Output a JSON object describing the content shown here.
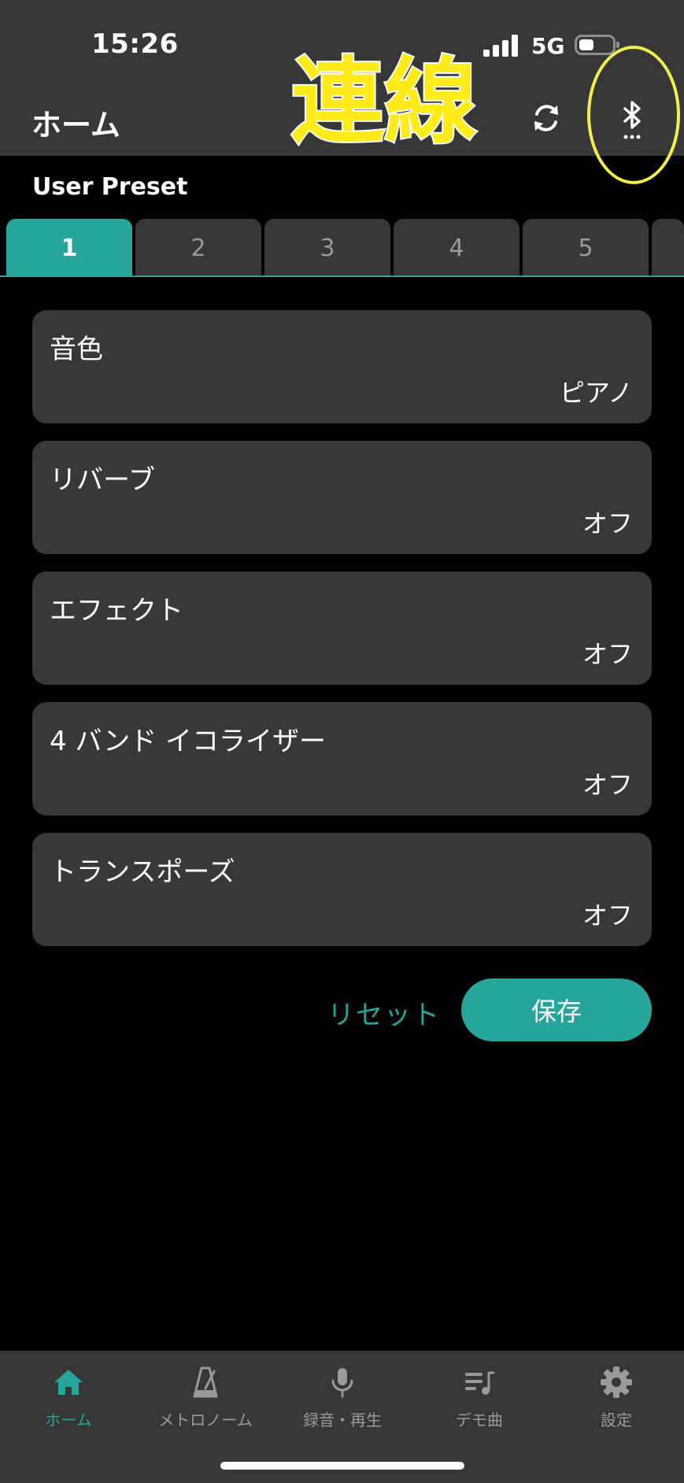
{
  "status_bar": {
    "time": "15:26",
    "network": "5G"
  },
  "header": {
    "title": "ホーム",
    "annotation": "連線"
  },
  "presets": {
    "label": "User Preset",
    "tabs": [
      "1",
      "2",
      "3",
      "4",
      "5"
    ],
    "active_index": 0
  },
  "settings": [
    {
      "label": "音色",
      "value": "ピアノ"
    },
    {
      "label": "リバーブ",
      "value": "オフ"
    },
    {
      "label": "エフェクト",
      "value": "オフ"
    },
    {
      "label": "4 バンド イコライザー",
      "value": "オフ"
    },
    {
      "label": "トランスポーズ",
      "value": "オフ"
    }
  ],
  "actions": {
    "reset_label": "リセット",
    "save_label": "保存"
  },
  "bottom_nav": [
    {
      "label": "ホーム",
      "icon": "home-icon",
      "active": true
    },
    {
      "label": "メトロノーム",
      "icon": "metronome-icon",
      "active": false
    },
    {
      "label": "録音・再生",
      "icon": "microphone-icon",
      "active": false
    },
    {
      "label": "デモ曲",
      "icon": "music-list-icon",
      "active": false
    },
    {
      "label": "設定",
      "icon": "gear-icon",
      "active": false
    }
  ],
  "colors": {
    "accent": "#26a69a",
    "surface": "#373737",
    "card": "#383838",
    "background": "#000000",
    "annotation": "#ffec1a"
  }
}
